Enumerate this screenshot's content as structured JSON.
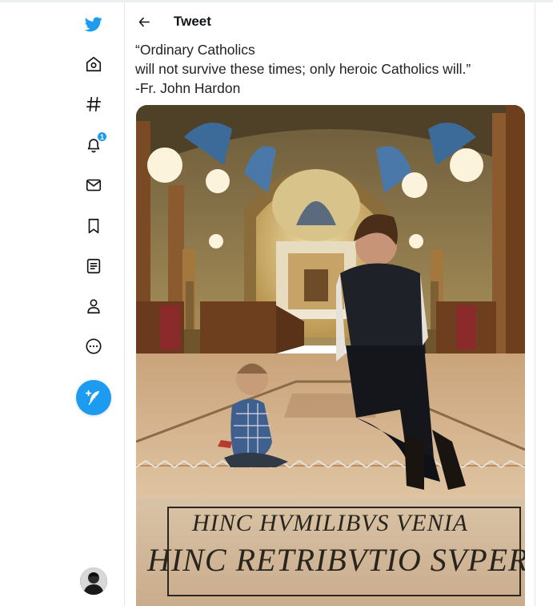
{
  "header": {
    "title": "Tweet",
    "back_icon": "arrow-left-icon"
  },
  "nav": {
    "items": [
      {
        "icon": "twitter-bird-icon",
        "name": "Twitter"
      },
      {
        "icon": "home-icon",
        "name": "Home"
      },
      {
        "icon": "hashtag-icon",
        "name": "Explore"
      },
      {
        "icon": "bell-icon",
        "name": "Notifications",
        "badge": "1"
      },
      {
        "icon": "envelope-icon",
        "name": "Messages"
      },
      {
        "icon": "bookmark-icon",
        "name": "Bookmarks"
      },
      {
        "icon": "list-icon",
        "name": "Lists"
      },
      {
        "icon": "person-icon",
        "name": "Profile"
      },
      {
        "icon": "more-circle-icon",
        "name": "More"
      }
    ],
    "compose_icon": "feather-plus-icon",
    "avatar_icon": "avatar-icon"
  },
  "tweet": {
    "lines": [
      "“Ordinary Catholics",
      "will not survive these times; only heroic Catholics will.”",
      "-Fr. John Hardon"
    ]
  },
  "media": {
    "inscription_line1": "HINC HVMILIBVS VENIA",
    "inscription_line2": "HINC RETRIBVTIO SVPERBIS"
  },
  "colors": {
    "accent": "#1d9bf0",
    "text": "#0f1419",
    "border": "#e3e6e8"
  }
}
